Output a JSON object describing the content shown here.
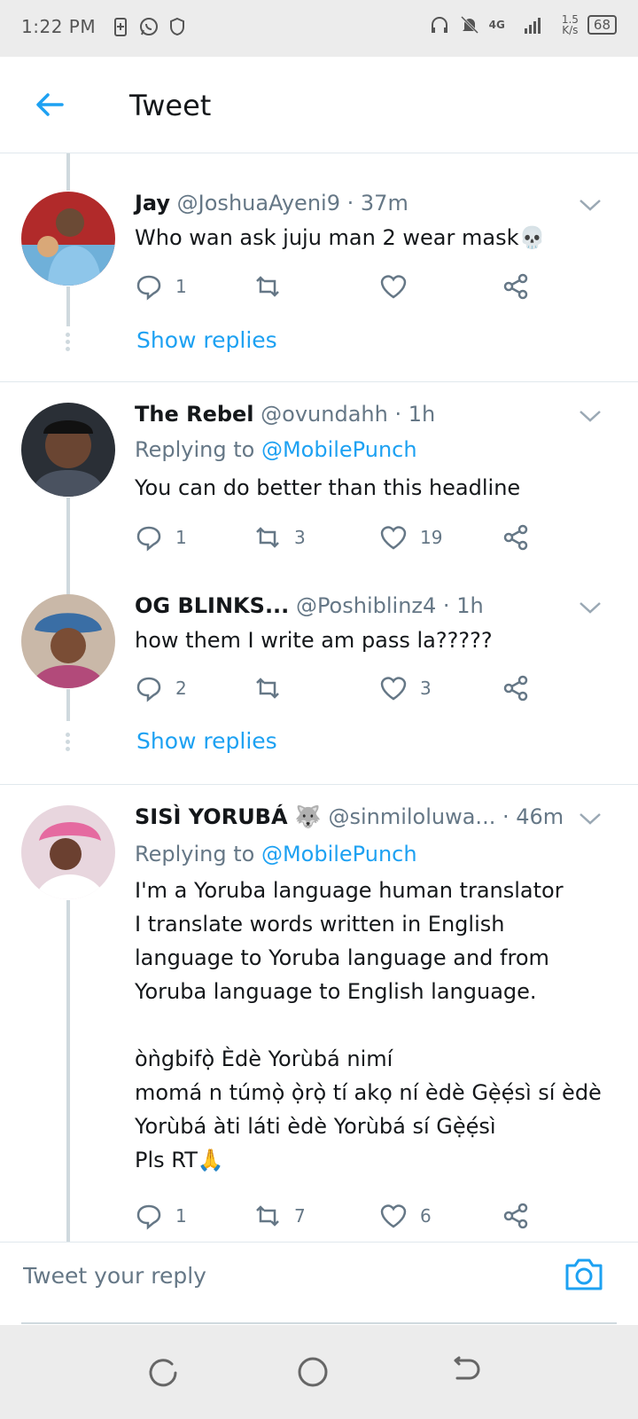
{
  "status_bar": {
    "time": "1:22 PM",
    "network": "4G",
    "speed_value": "1.5",
    "speed_unit": "K/s",
    "battery": "68",
    "icons": [
      "battery-saver-icon",
      "whatsapp-icon",
      "shield-icon",
      "headphones-icon",
      "bell-off-icon",
      "signal-icon"
    ]
  },
  "header": {
    "title": "Tweet",
    "back_icon": "back-arrow-icon"
  },
  "tweets": [
    {
      "name": "Jay",
      "handle": "@JoshuaAyeni9",
      "time": "37m",
      "replying_to": "",
      "text": "Who wan ask juju man 2 wear mask💀",
      "replies": "1",
      "retweets": "",
      "likes": "",
      "show_replies": "Show replies"
    },
    {
      "name": "The Rebel",
      "handle": "@ovundahh",
      "time": "1h",
      "replying_prefix": "Replying to",
      "replying_to": "@MobilePunch",
      "text": "You can do better than this headline",
      "replies": "1",
      "retweets": "3",
      "likes": "19"
    },
    {
      "name": "OG BLINKS...",
      "handle": "@Poshiblinz4",
      "time": "1h",
      "replying_to": "",
      "text": "how them I write am pass la?????",
      "replies": "2",
      "retweets": "",
      "likes": "3",
      "show_replies": "Show replies"
    },
    {
      "name": "SISÌ YORUBÁ 🐺",
      "handle": "@sinmiloluwa...",
      "time": "46m",
      "replying_prefix": "Replying to",
      "replying_to": "@MobilePunch",
      "text": "I'm a Yoruba language human translator\nI translate words written in English\nlanguage to Yoruba language and from\nYoruba language to English language.\n\nòǹgbifọ̀ Èdè Yorùbá nimí\nmomá n túmọ̀ ọ̀rọ̀ tí akọ ní èdè Gẹ̀ẹ́sì sí èdè\nYorùbá àti láti èdè Yorùbá sí Gẹ̀ẹ́sì\nPls RT🙏",
      "replies": "1",
      "retweets": "7",
      "likes": "6"
    }
  ],
  "reply_bar": {
    "placeholder": "Tweet your reply",
    "camera_icon": "camera-icon"
  },
  "colors": {
    "accent": "#1da1f2",
    "secondary_text": "#657786",
    "divider": "#e1e8ed"
  }
}
